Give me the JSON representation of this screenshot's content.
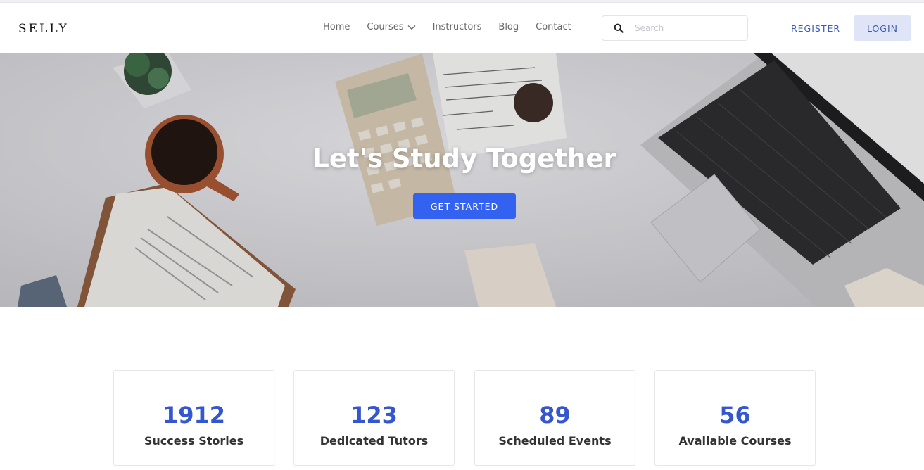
{
  "brand": {
    "logo": "SELLY"
  },
  "nav": {
    "items": [
      {
        "label": "Home"
      },
      {
        "label": "Courses"
      },
      {
        "label": "Instructors"
      },
      {
        "label": "Blog"
      },
      {
        "label": "Contact"
      }
    ]
  },
  "search": {
    "placeholder": "Search",
    "value": ""
  },
  "auth": {
    "register_label": "REGISTER",
    "login_label": "LOGIN"
  },
  "hero": {
    "title": "Let's Study Together",
    "cta_label": "GET STARTED"
  },
  "stats": [
    {
      "value": "1912",
      "label": "Success Stories"
    },
    {
      "value": "123",
      "label": "Dedicated Tutors"
    },
    {
      "value": "89",
      "label": "Scheduled Events"
    },
    {
      "value": "56",
      "label": "Available Courses"
    }
  ],
  "colors": {
    "accent": "#3362f0",
    "link": "#3b5bb5",
    "stat_number": "#3456cf",
    "login_bg": "#dfe5f7"
  },
  "icons": {
    "search": "search-icon",
    "courses_dropdown": "chevron-down-icon"
  }
}
